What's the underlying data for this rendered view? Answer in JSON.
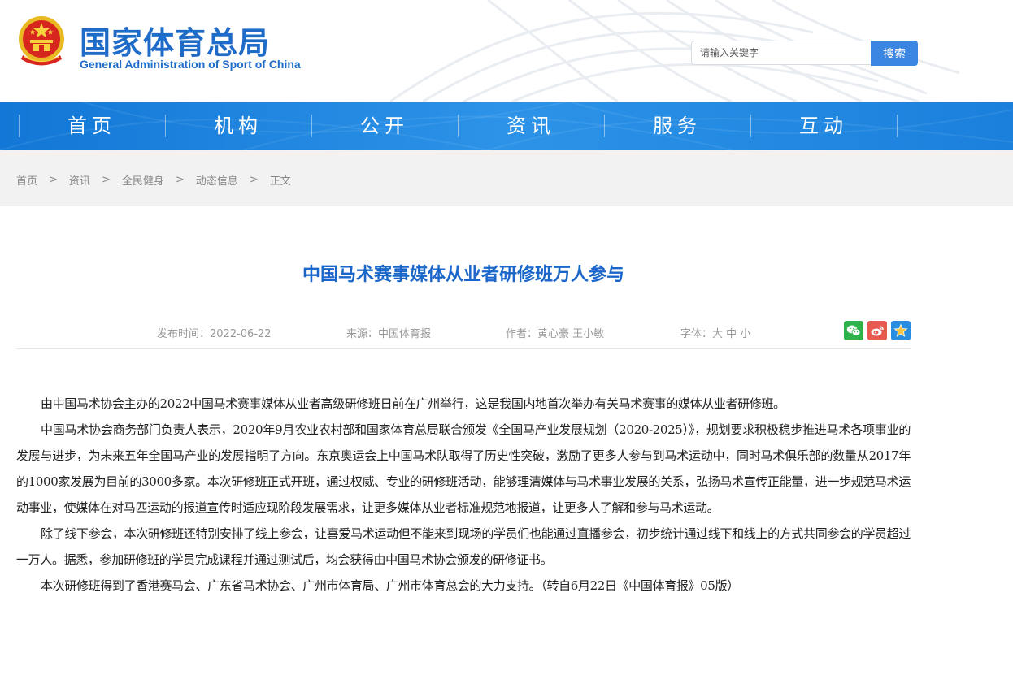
{
  "header": {
    "logo_cn": "国家体育总局",
    "logo_en": "General Administration of Sport of China",
    "search_placeholder": "请输入关键字",
    "search_button": "搜索"
  },
  "nav": {
    "items": [
      {
        "label": "首页"
      },
      {
        "label": "机构"
      },
      {
        "label": "公开"
      },
      {
        "label": "资讯"
      },
      {
        "label": "服务"
      },
      {
        "label": "互动"
      }
    ]
  },
  "breadcrumb": {
    "items": [
      "首页",
      "资讯",
      "全民健身",
      "动态信息",
      "正文"
    ],
    "separator": ">"
  },
  "article": {
    "title": "中国马术赛事媒体从业者研修班万人参与",
    "publish_time": "发布时间：2022-06-22",
    "source": "来源：中国体育报",
    "author": "作者：黄心豪 王小敏",
    "font_size_label": "字体：",
    "font_large": "大",
    "font_medium": "中",
    "font_small": "小",
    "paragraphs": [
      "由中国马术协会主办的2022中国马术赛事媒体从业者高级研修班日前在广州举行，这是我国内地首次举办有关马术赛事的媒体从业者研修班。",
      "中国马术协会商务部门负责人表示，2020年9月农业农村部和国家体育总局联合颁发《全国马产业发展规划（2020-2025）》，规划要求积极稳步推进马术各项事业的发展与进步，为未来五年全国马产业的发展指明了方向。东京奥运会上中国马术队取得了历史性突破，激励了更多人参与到马术运动中，同时马术俱乐部的数量从2017年的1000家发展为目前的3000多家。本次研修班正式开班，通过权威、专业的研修班活动，能够理清媒体与马术事业发展的关系，弘扬马术宣传正能量，进一步规范马术运动事业，使媒体在对马匹运动的报道宣传时适应现阶段发展需求，让更多媒体从业者标准规范地报道，让更多人了解和参与马术运动。",
      "除了线下参会，本次研修班还特别安排了线上参会，让喜爱马术运动但不能来到现场的学员们也能通过直播参会，初步统计通过线下和线上的方式共同参会的学员超过一万人。据悉，参加研修班的学员完成课程并通过测试后，均会获得由中国马术协会颁发的研修证书。",
      "本次研修班得到了香港赛马会、广东省马术协会、广州市体育局、广州市体育总会的大力支持。（转自6月22日《中国体育报》05版）"
    ]
  },
  "share_icons": [
    {
      "name": "wechat-icon",
      "color": "#2fb24a"
    },
    {
      "name": "weibo-icon",
      "color": "#e8594f"
    },
    {
      "name": "favorite-star-icon",
      "color": "#2a8ee0"
    }
  ],
  "colors": {
    "brand_blue": "#1f6bc8",
    "nav_blue": "#1a80dc",
    "title_blue": "#1b66c9"
  }
}
